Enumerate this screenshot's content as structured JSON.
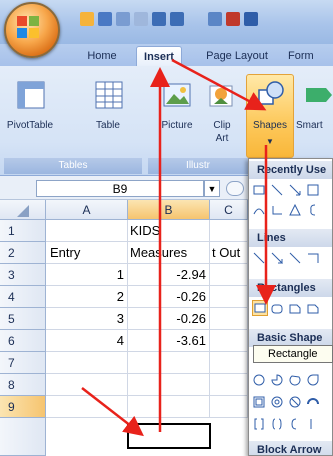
{
  "tabs": [
    {
      "label": "Home"
    },
    {
      "label": "Insert",
      "active": true
    },
    {
      "label": "Page Layout"
    },
    {
      "label": "Form"
    }
  ],
  "ribbon": {
    "tables_group": {
      "label": "Tables",
      "pivot_label": "PivotTable",
      "table_label": "Table"
    },
    "illustrations_group": {
      "label": "Illustr",
      "picture_label": "Picture",
      "clip_label": "Clip",
      "art_label": "Art",
      "shapes_label": "Shapes",
      "smart_label": "Smart"
    }
  },
  "formula_bar": {
    "name_box": "B9"
  },
  "columns": [
    "A",
    "B",
    "C"
  ],
  "rows": [
    {
      "n": "1",
      "a": "",
      "b": "KIDS",
      "c": ""
    },
    {
      "n": "2",
      "a": "Entry",
      "b": "Measures",
      "c": "t Out"
    },
    {
      "n": "3",
      "a": "1",
      "b": "-2.94",
      "c": ""
    },
    {
      "n": "4",
      "a": "2",
      "b": "-0.26",
      "c": ""
    },
    {
      "n": "5",
      "a": "3",
      "b": "-0.26",
      "c": ""
    },
    {
      "n": "6",
      "a": "4",
      "b": "-3.61",
      "c": ""
    },
    {
      "n": "7",
      "a": "",
      "b": "",
      "c": ""
    },
    {
      "n": "8",
      "a": "",
      "b": "",
      "c": ""
    },
    {
      "n": "9",
      "a": "",
      "b": "",
      "c": ""
    }
  ],
  "shapes_menu": {
    "recent": "Recently Use",
    "lines": "Lines",
    "rectangles": "Rectangles",
    "basic": "Basic Shape",
    "block": "Block Arrow",
    "tooltip": "Rectangle"
  },
  "colors": {
    "arrow": "#e8221b",
    "selection": "#000000",
    "ribbon": "#d5e3f6"
  }
}
